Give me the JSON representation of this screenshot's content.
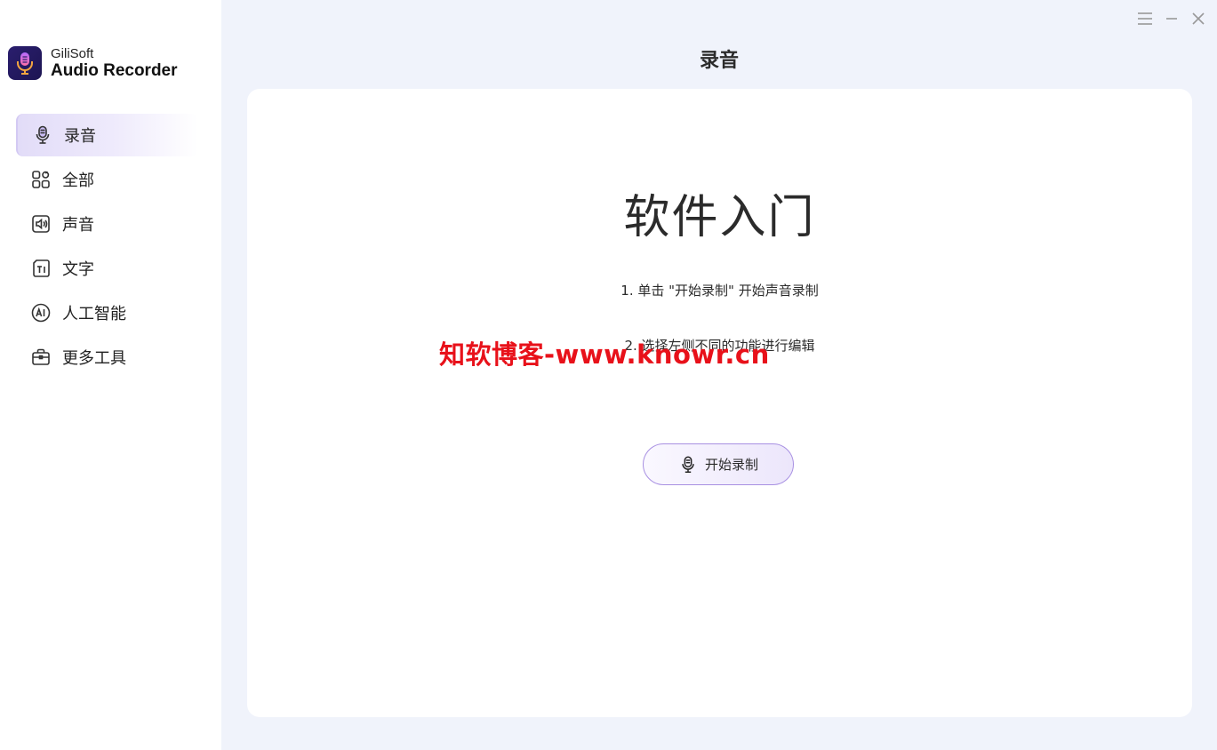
{
  "app": {
    "brand": "GiliSoft",
    "product": "Audio Recorder"
  },
  "sidebar": {
    "items": [
      {
        "label": "录音",
        "icon": "microphone-icon",
        "active": true
      },
      {
        "label": "全部",
        "icon": "apps-grid-icon",
        "active": false
      },
      {
        "label": "声音",
        "icon": "speaker-icon",
        "active": false
      },
      {
        "label": "文字",
        "icon": "text-icon",
        "active": false
      },
      {
        "label": "人工智能",
        "icon": "ai-icon",
        "active": false
      },
      {
        "label": "更多工具",
        "icon": "toolbox-icon",
        "active": false
      }
    ]
  },
  "header": {
    "title": "录音"
  },
  "main": {
    "heading": "软件入门",
    "steps": [
      "1. 单击 \"开始录制\" 开始声音录制",
      "2. 选择左侧不同的功能进行编辑"
    ],
    "start_button_label": "开始录制"
  },
  "watermark": "知软博客-www.knowr.cn",
  "colors": {
    "accent": "#a890e2",
    "active_nav_bg": "#e2dcf8",
    "background": "#f0f3fb",
    "watermark": "#e8111a"
  }
}
